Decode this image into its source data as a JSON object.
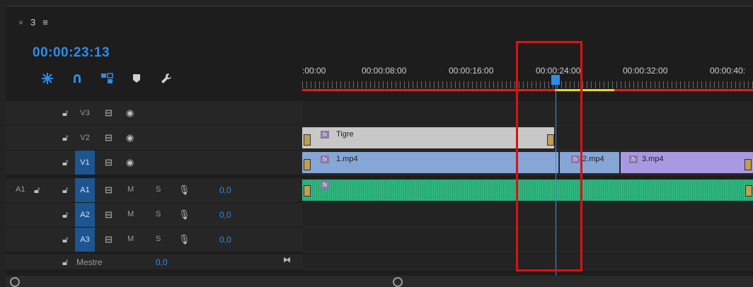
{
  "tab": {
    "close": "×",
    "name": "3",
    "menu": "≡"
  },
  "timecode": "00:00:23:13",
  "tools": [
    "snap-icon",
    "magnet-icon",
    "linked-selection-icon",
    "marker-icon",
    "wrench-icon"
  ],
  "ruler": {
    "labels": [
      ":00:00",
      "00:00:08:00",
      "00:00:16:00",
      "00:00:24:00",
      "00:00:32:00",
      "00:00:40:"
    ]
  },
  "tracks": {
    "video": [
      {
        "name": "V3",
        "selected": false
      },
      {
        "name": "V2",
        "selected": false
      },
      {
        "name": "V1",
        "selected": true
      }
    ],
    "audio": [
      {
        "source": "A1",
        "name": "A1",
        "m": "M",
        "s": "S",
        "vol": "0,0"
      },
      {
        "source": "",
        "name": "A2",
        "m": "M",
        "s": "S",
        "vol": "0,0"
      },
      {
        "source": "",
        "name": "A3",
        "m": "M",
        "s": "S",
        "vol": "0,0"
      }
    ],
    "master": {
      "label": "Mestre",
      "vol": "0,0"
    }
  },
  "clips": {
    "v2": [
      {
        "name": "Tigre",
        "fx": "fx"
      }
    ],
    "v1": [
      {
        "name": "1.mp4",
        "fx": "fx"
      },
      {
        "name": "2.mp4",
        "fx": "fx"
      },
      {
        "name": "3.mp4",
        "fx": "fx"
      }
    ]
  },
  "colors": {
    "accent": "#2d8ceb",
    "clip_video": "#86a6d6",
    "clip_video_alt": "#a999e3",
    "clip_title": "#c8c8c8",
    "clip_audio": "#2fb77f",
    "work_red": "#e02020",
    "work_yellow": "#e6d71d",
    "annotation": "#e01010"
  }
}
